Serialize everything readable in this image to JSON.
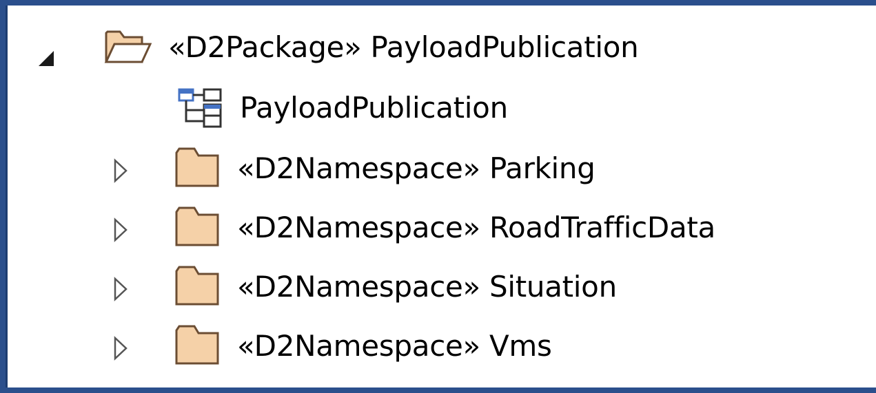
{
  "tree": {
    "root": {
      "label": "«D2Package» PayloadPublication",
      "expanded": true,
      "icon": "open-folder-icon",
      "children": [
        {
          "label": "PayloadPublication",
          "icon": "class-diagram-icon"
        },
        {
          "label": "«D2Namespace» Parking",
          "icon": "folder-icon",
          "expanded": false
        },
        {
          "label": "«D2Namespace» RoadTrafficData",
          "icon": "folder-icon",
          "expanded": false
        },
        {
          "label": "«D2Namespace» Situation",
          "icon": "folder-icon",
          "expanded": false
        },
        {
          "label": "«D2Namespace» Vms",
          "icon": "folder-icon",
          "expanded": false
        }
      ]
    }
  },
  "colors": {
    "window_border": "#2b4f8c",
    "folder_fill": "#f5d1a8",
    "folder_stroke": "#6b4d33",
    "diagram_blue": "#4472c4"
  }
}
